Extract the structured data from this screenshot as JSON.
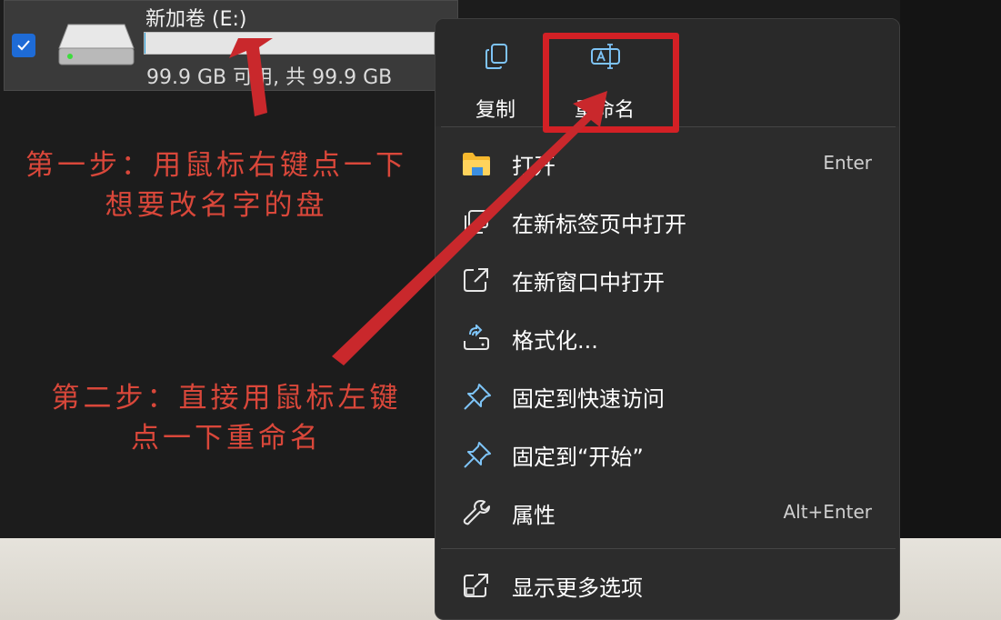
{
  "drive": {
    "name": "新加卷 (E:)",
    "capacity_text": "99.9 GB 可用, 共 99.9 GB",
    "used_fraction": 0.001,
    "checked": true
  },
  "annotations": {
    "step1_line1": "第一步：用鼠标右键点一下",
    "step1_line2": "想要改名字的盘",
    "step2_line1": "第二步：直接用鼠标左键",
    "step2_line2": "点一下重命名"
  },
  "context_menu": {
    "top_actions": [
      {
        "label": "复制",
        "icon": "copy-icon"
      },
      {
        "label": "重命名",
        "icon": "rename-icon"
      }
    ],
    "items": [
      {
        "label": "打开",
        "shortcut": "Enter",
        "icon": "folder-icon"
      },
      {
        "label": "在新标签页中打开",
        "shortcut": "",
        "icon": "new-tab-icon"
      },
      {
        "label": "在新窗口中打开",
        "shortcut": "",
        "icon": "open-external-icon"
      },
      {
        "label": "格式化...",
        "shortcut": "",
        "icon": "format-icon"
      },
      {
        "label": "固定到快速访问",
        "shortcut": "",
        "icon": "pin-icon"
      },
      {
        "label": "固定到“开始”",
        "shortcut": "",
        "icon": "pin-icon"
      },
      {
        "label": "属性",
        "shortcut": "Alt+Enter",
        "icon": "wrench-icon"
      }
    ],
    "more_options": {
      "label": "显示更多选项",
      "icon": "show-more-icon"
    }
  },
  "colors": {
    "annotation_red": "#d32025",
    "annotation_text": "#d9473a",
    "checkbox_blue": "#1e6bd6",
    "menu_bg": "#2c2c2c",
    "accent_icon": "#7ec4f7"
  }
}
